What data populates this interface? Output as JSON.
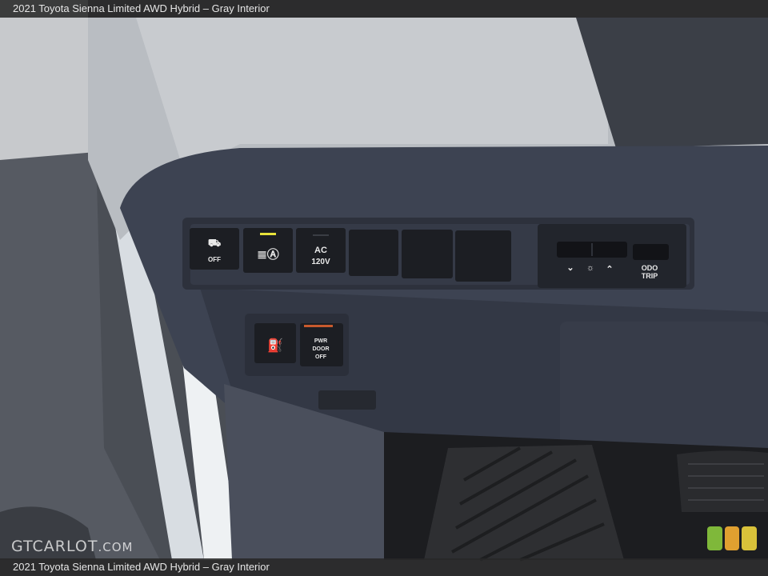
{
  "caption": {
    "top": "2021 Toyota Sienna Limited AWD Hybrid – Gray Interior",
    "bottom": "2021 Toyota Sienna Limited AWD Hybrid – Gray Interior"
  },
  "watermark": {
    "main": "GTCARLOT",
    "suffix": ".COM"
  },
  "switches": {
    "vsc_off": "OFF",
    "ac_120v_line1": "AC",
    "ac_120v_line2": "120V",
    "odo_line1": "ODO",
    "odo_line2": "TRIP",
    "fuel_label": "",
    "pwr_door_line1": "PWR",
    "pwr_door_line2": "DOOR",
    "pwr_door_line3": "OFF"
  },
  "colors": {
    "dash_upper": "#b9bdc2",
    "dash_panel": "#3d4352",
    "badge_green": "#7fb83a",
    "badge_orange": "#e0a030",
    "badge_yellow": "#d9c23a",
    "indicator_yellow": "#e8e23a"
  }
}
